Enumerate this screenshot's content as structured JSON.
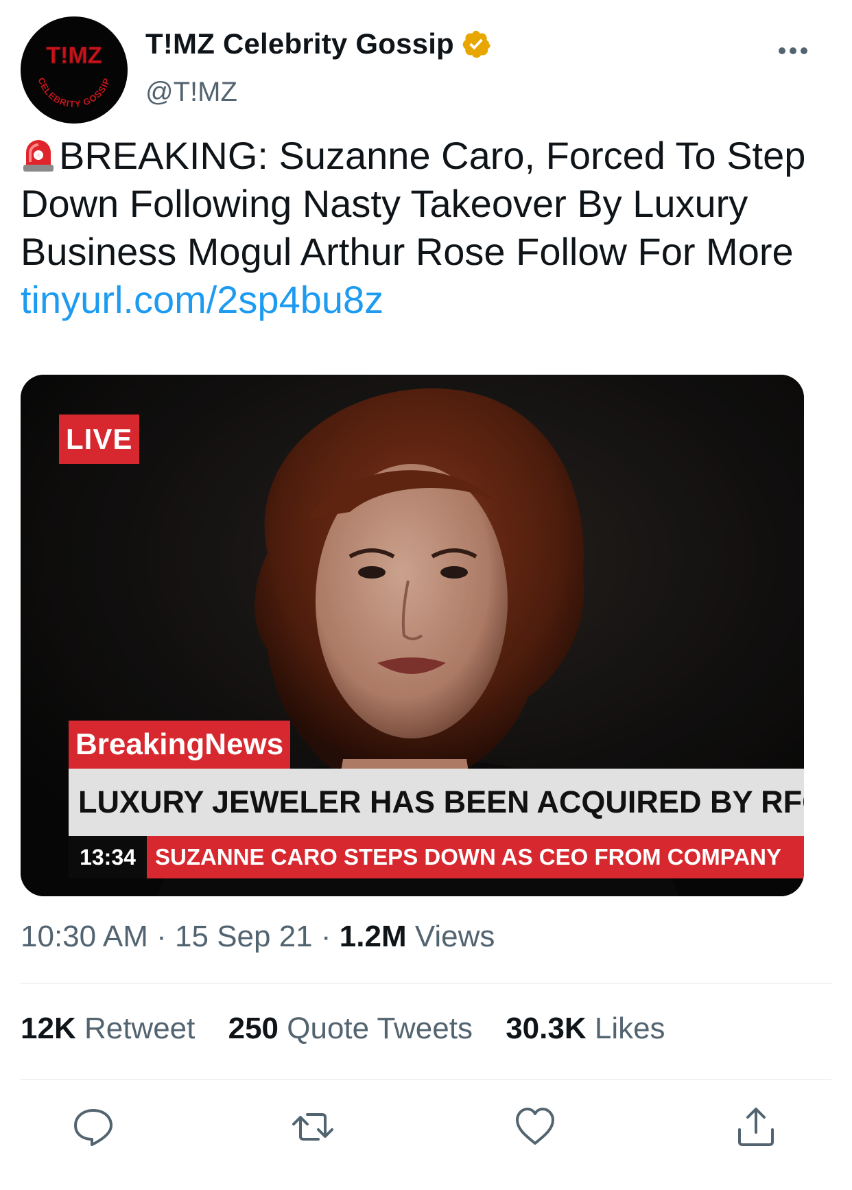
{
  "author": {
    "display_name": "T!MZ Celebrity Gossip",
    "handle": "@T!MZ",
    "avatar_logo_text": "T!MZ",
    "avatar_ring_text": "CELEBRITY GOSSIP",
    "verified": true,
    "verified_color": "#e8a600"
  },
  "tweet": {
    "text": "BREAKING: Suzanne Caro, Forced To Step Down Following Nasty Takeover By Luxury Business Mogul Arthur Rose Follow For More ",
    "link": "tinyurl.com/2sp4bu8z",
    "link_color": "#1d9bf0",
    "leading_icon": "siren-icon"
  },
  "media": {
    "live_label": "LIVE",
    "breaking_label": "BreakingNews",
    "headline": "LUXURY JEWELER HAS BEEN ACQUIRED BY RFG",
    "ticker_time": "13:34",
    "ticker_text": "SUZANNE CARO STEPS DOWN AS CEO FROM COMPANY",
    "accent_color": "#d7282f"
  },
  "meta": {
    "time": "10:30 AM",
    "date": "15 Sep 21",
    "views_count": "1.2M",
    "views_label": "Views",
    "separator": "·"
  },
  "stats": {
    "retweets_count": "12K",
    "retweets_label": "Retweet",
    "quotes_count": "250",
    "quotes_label": "Quote Tweets",
    "likes_count": "30.3K",
    "likes_label": "Likes"
  },
  "actions": [
    "reply-icon",
    "retweet-icon",
    "like-icon",
    "share-icon"
  ]
}
